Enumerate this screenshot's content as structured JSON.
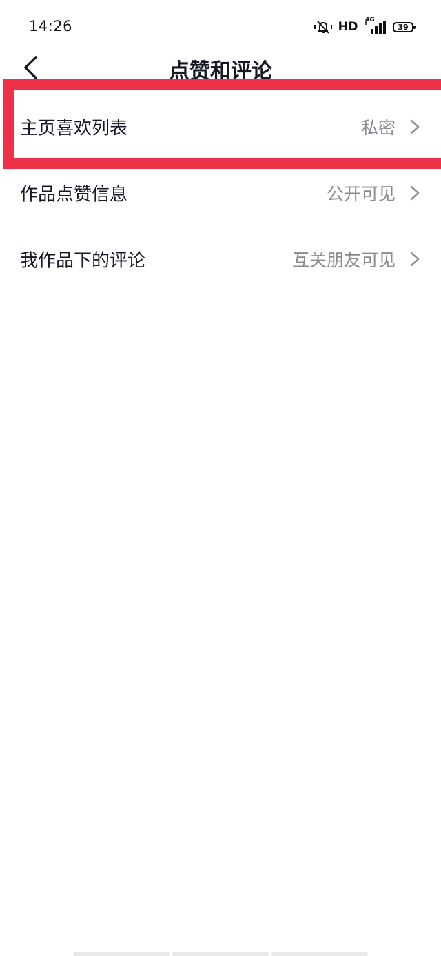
{
  "status_bar": {
    "time": "14:26",
    "network": "HD",
    "signal_type": "4G",
    "battery": "39"
  },
  "nav": {
    "title": "点赞和评论"
  },
  "settings": [
    {
      "label": "主页喜欢列表",
      "value": "私密"
    },
    {
      "label": "作品点赞信息",
      "value": "公开可见"
    },
    {
      "label": "我作品下的评论",
      "value": "互关朋友可见"
    }
  ],
  "colors": {
    "highlight": "#ee3149",
    "value_text": "#8a8b91",
    "primary_text": "#161823"
  }
}
